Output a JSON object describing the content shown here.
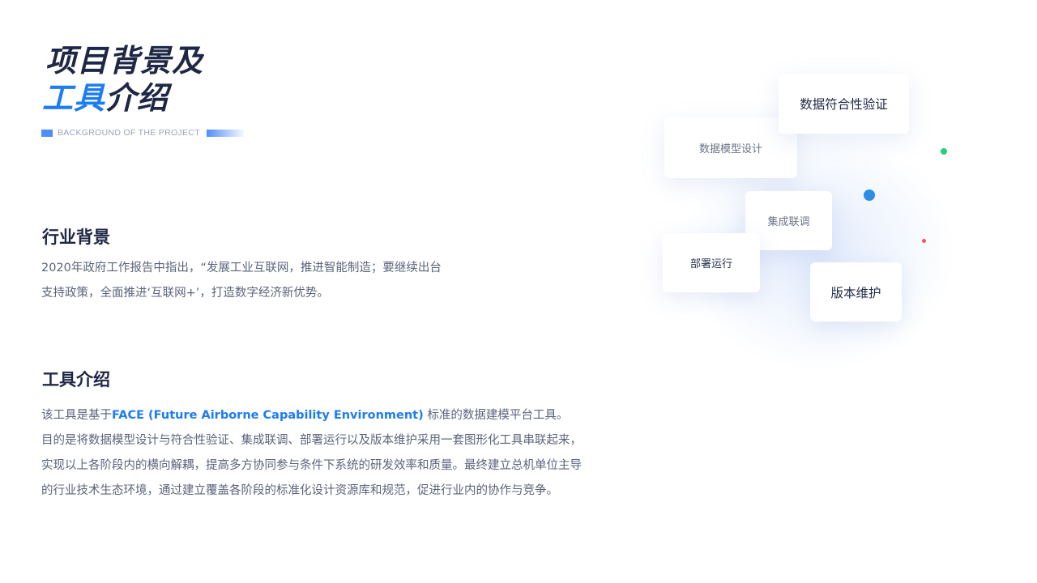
{
  "title": {
    "line1": "项目背景及",
    "line2_accent": "工具",
    "line2_rest": "介绍",
    "subtitle": "BACKGROUND OF THE PROJECT"
  },
  "industry": {
    "heading": "行业背景",
    "lines": [
      "2020年政府工作报告中指出，“发展工业互联网，推进智能制造；要继续出台",
      "支持政策，全面推进‘互联网+’，打造数字经济新优势。"
    ]
  },
  "tool": {
    "heading": "工具介绍",
    "line1_pre": "该工具是基于",
    "line1_highlight": "FACE (Future Airborne Capability Environment)",
    "line1_post": " 标准的数据建模平台工具。",
    "lines": [
      "目的是将数据模型设计与符合性验证、集成联调、部署运行以及版本维护采用一套图形化工具串联起来，",
      "实现以上各阶段内的横向解耦，提高多方协同参与条件下系统的研发效率和质量。最终建立总机单位主导",
      "的行业技术生态环境，通过建立覆盖各阶段的标准化设计资源库和规范，促进行业内的协作与竞争。"
    ]
  },
  "cards": {
    "conformance": "数据符合性验证",
    "model_design": "数据模型设计",
    "integration": "集成联调",
    "deployment": "部署运行",
    "version": "版本维护"
  },
  "colors": {
    "accent": "#1e7cf2",
    "dark": "#1f2746",
    "dot_green": "#25d07c",
    "dot_blue": "#2b8de6",
    "dot_red": "#f05a5a"
  }
}
